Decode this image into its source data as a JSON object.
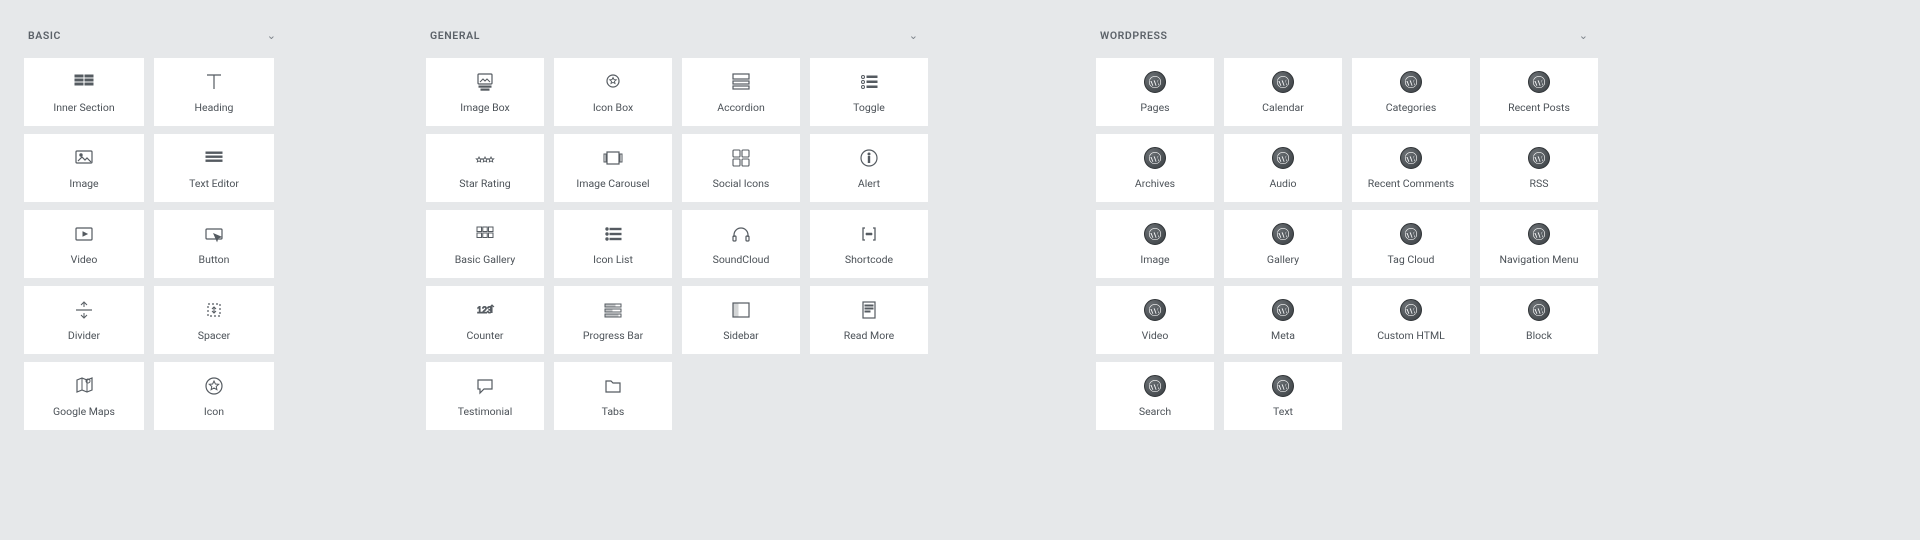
{
  "sections": {
    "basic": {
      "title": "BASIC",
      "widgets": [
        {
          "name": "inner-section",
          "label": "Inner Section",
          "icon": "columns"
        },
        {
          "name": "heading",
          "label": "Heading",
          "icon": "heading"
        },
        {
          "name": "image",
          "label": "Image",
          "icon": "image"
        },
        {
          "name": "text-editor",
          "label": "Text Editor",
          "icon": "text-lines"
        },
        {
          "name": "video",
          "label": "Video",
          "icon": "video"
        },
        {
          "name": "button",
          "label": "Button",
          "icon": "button"
        },
        {
          "name": "divider",
          "label": "Divider",
          "icon": "divider"
        },
        {
          "name": "spacer",
          "label": "Spacer",
          "icon": "spacer"
        },
        {
          "name": "google-maps",
          "label": "Google Maps",
          "icon": "map"
        },
        {
          "name": "icon",
          "label": "Icon",
          "icon": "star-circle"
        }
      ]
    },
    "general": {
      "title": "GENERAL",
      "widgets": [
        {
          "name": "image-box",
          "label": "Image Box",
          "icon": "image-box"
        },
        {
          "name": "icon-box",
          "label": "Icon Box",
          "icon": "star-badge"
        },
        {
          "name": "accordion",
          "label": "Accordion",
          "icon": "accordion"
        },
        {
          "name": "toggle",
          "label": "Toggle",
          "icon": "toggle-list"
        },
        {
          "name": "star-rating",
          "label": "Star Rating",
          "icon": "stars"
        },
        {
          "name": "image-carousel",
          "label": "Image Carousel",
          "icon": "carousel"
        },
        {
          "name": "social-icons",
          "label": "Social Icons",
          "icon": "social"
        },
        {
          "name": "alert",
          "label": "Alert",
          "icon": "info"
        },
        {
          "name": "basic-gallery",
          "label": "Basic Gallery",
          "icon": "gallery"
        },
        {
          "name": "icon-list",
          "label": "Icon List",
          "icon": "icon-list"
        },
        {
          "name": "soundcloud",
          "label": "SoundCloud",
          "icon": "headphones"
        },
        {
          "name": "shortcode",
          "label": "Shortcode",
          "icon": "brackets"
        },
        {
          "name": "counter",
          "label": "Counter",
          "icon": "counter"
        },
        {
          "name": "progress-bar",
          "label": "Progress Bar",
          "icon": "progress"
        },
        {
          "name": "sidebar",
          "label": "Sidebar",
          "icon": "sidebar"
        },
        {
          "name": "read-more",
          "label": "Read More",
          "icon": "read-more"
        },
        {
          "name": "testimonial",
          "label": "Testimonial",
          "icon": "chat"
        },
        {
          "name": "tabs",
          "label": "Tabs",
          "icon": "folder"
        }
      ]
    },
    "wordpress": {
      "title": "WORDPRESS",
      "widgets": [
        {
          "name": "pages",
          "label": "Pages",
          "icon": "wp"
        },
        {
          "name": "calendar",
          "label": "Calendar",
          "icon": "wp"
        },
        {
          "name": "categories",
          "label": "Categories",
          "icon": "wp"
        },
        {
          "name": "recent-posts",
          "label": "Recent Posts",
          "icon": "wp"
        },
        {
          "name": "archives",
          "label": "Archives",
          "icon": "wp"
        },
        {
          "name": "audio",
          "label": "Audio",
          "icon": "wp"
        },
        {
          "name": "recent-comments",
          "label": "Recent Comments",
          "icon": "wp"
        },
        {
          "name": "rss",
          "label": "RSS",
          "icon": "wp"
        },
        {
          "name": "image",
          "label": "Image",
          "icon": "wp"
        },
        {
          "name": "gallery",
          "label": "Gallery",
          "icon": "wp"
        },
        {
          "name": "tag-cloud",
          "label": "Tag Cloud",
          "icon": "wp"
        },
        {
          "name": "navigation-menu",
          "label": "Navigation Menu",
          "icon": "wp"
        },
        {
          "name": "video",
          "label": "Video",
          "icon": "wp"
        },
        {
          "name": "meta",
          "label": "Meta",
          "icon": "wp"
        },
        {
          "name": "custom-html",
          "label": "Custom HTML",
          "icon": "wp"
        },
        {
          "name": "block",
          "label": "Block",
          "icon": "wp"
        },
        {
          "name": "search",
          "label": "Search",
          "icon": "wp"
        },
        {
          "name": "text",
          "label": "Text",
          "icon": "wp"
        }
      ]
    }
  }
}
